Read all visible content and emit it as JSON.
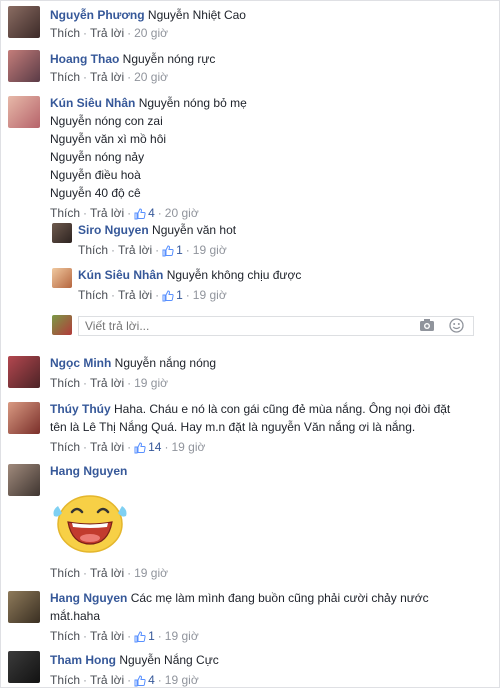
{
  "actions": {
    "like": "Thích",
    "reply": "Trả lời"
  },
  "comments": [
    {
      "name": "Nguyễn Phương",
      "lines": [
        "Nguyễn Nhiệt Cao"
      ],
      "time": "20 giờ",
      "likes": ""
    },
    {
      "name": "Hoang Thao",
      "lines": [
        "Nguyễn nóng rực"
      ],
      "time": "20 giờ",
      "likes": ""
    },
    {
      "name": "Kún Siêu Nhân",
      "lines": [
        "Nguyễn nóng bỏ mẹ",
        "Nguyễn nóng con zai",
        "Nguyễn văn xì mồ hôi",
        "Nguyễn nóng nảy",
        "Nguyễn điều hoà",
        "Nguyễn 40 độ cê"
      ],
      "time": "20 giờ",
      "likes": "4"
    },
    {
      "name": "Siro Nguyen",
      "lines": [
        "Nguyễn văn hot"
      ],
      "time": "19 giờ",
      "likes": "1"
    },
    {
      "name": "Kún Siêu Nhân",
      "lines": [
        "Nguyễn không chịu được"
      ],
      "time": "19 giờ",
      "likes": "1"
    },
    {
      "name": "Ngọc Minh",
      "lines": [
        "Nguyễn nắng nóng"
      ],
      "time": "19 giờ",
      "likes": ""
    },
    {
      "name": "Thúy Thúy",
      "lines": [
        "Haha. Cháu e nó là con gái cũng đẻ mùa nắng. Ông nọi đòi đặt",
        "tên là Lê Thị Nắng Quá. Hay m.n đặt là nguyễn Văn nắng ơi là nắng."
      ],
      "time": "19 giờ",
      "likes": "14"
    },
    {
      "name": "Hang Nguyen",
      "lines": [
        ""
      ],
      "time": "19 giờ",
      "likes": ""
    },
    {
      "name": "Hang Nguyen",
      "lines": [
        "Các mẹ làm mình đang buồn cũng phải cười chảy nước",
        "mắt.haha"
      ],
      "time": "19 giờ",
      "likes": "1"
    },
    {
      "name": "Tham Hong",
      "lines": [
        "Nguyễn Nắng Cực"
      ],
      "time": "19 giờ",
      "likes": "4"
    }
  ],
  "reply_input": {
    "placeholder": "Viết trả lời..."
  },
  "icons": {
    "like": "thumbs-up-icon",
    "camera": "camera-icon",
    "emoji": "smiley-icon",
    "sticker": "laughing-emoji-sticker"
  },
  "colors": {
    "name": "#365899",
    "meta": "#90949c",
    "like_icon": "#5890ff"
  }
}
